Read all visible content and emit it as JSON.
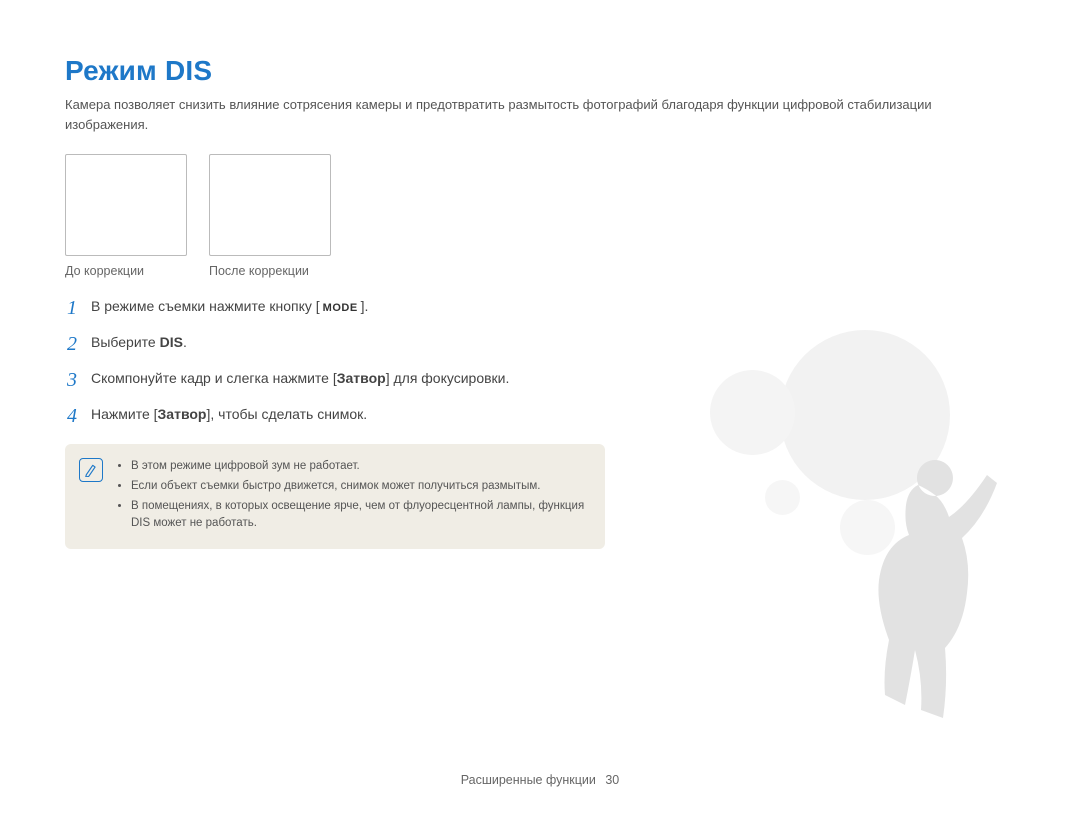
{
  "title": "Режим DIS",
  "intro": "Камера позволяет снизить влияние сотрясения камеры и предотвратить размытость фотографий благодаря функции цифровой стабилизации изображения.",
  "compare": {
    "before": "До коррекции",
    "after": "После коррекции"
  },
  "steps": [
    {
      "num": "1",
      "pre": "В режиме съемки нажмите кнопку [",
      "mode": "MODE",
      "post": "]."
    },
    {
      "num": "2",
      "pre": "Выберите ",
      "bold": "DIS",
      "post": "."
    },
    {
      "num": "3",
      "pre": "Скомпонуйте кадр и слегка нажмите [",
      "bold": "Затвор",
      "post": "] для фокусировки."
    },
    {
      "num": "4",
      "pre": "Нажмите [",
      "bold": "Затвор",
      "post": "], чтобы сделать снимок."
    }
  ],
  "notes": [
    "В этом режиме цифровой зум не работает.",
    "Если объект съемки быстро движется, снимок может получиться размытым.",
    "В помещениях, в которых освещение ярче, чем от флуоресцентной лампы, функция DIS может не работать."
  ],
  "footer": {
    "section": "Расширенные функции",
    "page": "30"
  }
}
